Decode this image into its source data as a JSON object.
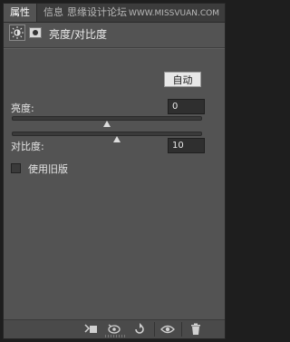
{
  "tabs": [
    {
      "label": "属性",
      "active": true
    },
    {
      "label": "信息",
      "active": false
    }
  ],
  "watermark": {
    "text_cn": "思缘设计论坛",
    "text_url": "WWW.MISSVUAN.COM"
  },
  "header": {
    "adjustment_icon": "brightness-contrast-adjustment-icon",
    "mask_icon": "layer-mask-icon",
    "title": "亮度/对比度"
  },
  "auto_button": {
    "label": "自动"
  },
  "brightness": {
    "label": "亮度:",
    "value": "0",
    "slider_fraction": 0.5
  },
  "contrast": {
    "label": "对比度:",
    "value": "10",
    "slider_fraction": 0.55
  },
  "legacy": {
    "label": "使用旧版",
    "checked": false
  },
  "toolbar": {
    "icons": [
      "clip-to-layer-icon",
      "view-previous-state-icon",
      "reset-icon",
      "visibility-eye-icon",
      "trash-icon"
    ]
  },
  "colors": {
    "panel_bg": "#535353",
    "tab_bg": "#3c3c3c",
    "field_bg": "#2f2f2f",
    "button_bg": "#e8e8e8"
  }
}
